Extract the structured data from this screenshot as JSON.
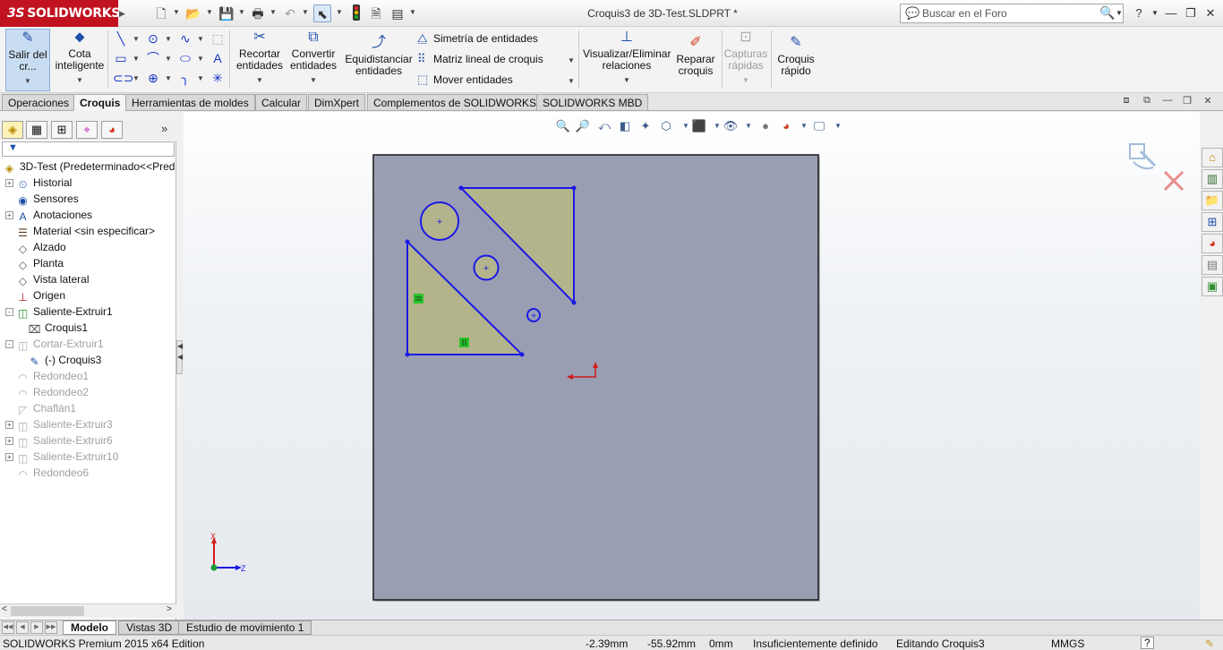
{
  "titlebar": {
    "brand": "SOLIDWORKS",
    "brand_prefix": "3S",
    "document_title": "Croquis3 de 3D-Test.SLDPRT *",
    "search_placeholder": "Buscar en el Foro",
    "help_label": "?",
    "icons": [
      "new-document-icon",
      "open-folder-icon",
      "save-icon",
      "print-icon",
      "undo-icon",
      "select-arrow-icon",
      "rebuild-traffic-light-icon",
      "file-properties-icon",
      "options-icon"
    ]
  },
  "ribbon": {
    "exit_sketch": "Salir del cr...",
    "smart_dimension": [
      "Cota",
      "inteligente"
    ],
    "trim": [
      "Recortar",
      "entidades"
    ],
    "convert": [
      "Convertir",
      "entidades"
    ],
    "offset": [
      "Equidistanciar",
      "entidades"
    ],
    "mirror": "Simetría de entidades",
    "linear_pattern": "Matriz lineal de croquis",
    "move": "Mover entidades",
    "relations": [
      "Visualizar/Eliminar",
      "relaciones"
    ],
    "repair": [
      "Reparar",
      "croquis"
    ],
    "quick_snaps": [
      "Capturas",
      "rápidas"
    ],
    "rapid_sketch": [
      "Croquis",
      "rápido"
    ]
  },
  "command_tabs": [
    {
      "label": "Operaciones",
      "active": false
    },
    {
      "label": "Croquis",
      "active": true
    },
    {
      "label": "Herramientas de moldes",
      "active": false
    },
    {
      "label": "Calcular",
      "active": false
    },
    {
      "label": "DimXpert",
      "active": false
    },
    {
      "label": "Complementos de SOLIDWORKS",
      "active": false
    },
    {
      "label": "SOLIDWORKS MBD",
      "active": false
    }
  ],
  "feature_tree": {
    "root": "3D-Test  (Predeterminado<<Pred",
    "items": [
      {
        "label": "Historial",
        "icon": "history-icon",
        "expander": "+",
        "dim": false
      },
      {
        "label": "Sensores",
        "icon": "sensor-icon",
        "expander": "",
        "dim": false
      },
      {
        "label": "Anotaciones",
        "icon": "annotations-icon",
        "expander": "+",
        "dim": false
      },
      {
        "label": "Material <sin especificar>",
        "icon": "material-icon",
        "expander": "",
        "dim": false
      },
      {
        "label": "Alzado",
        "icon": "plane-icon",
        "expander": "",
        "dim": false
      },
      {
        "label": "Planta",
        "icon": "plane-icon",
        "expander": "",
        "dim": false
      },
      {
        "label": "Vista lateral",
        "icon": "plane-icon",
        "expander": "",
        "dim": false
      },
      {
        "label": "Origen",
        "icon": "origin-icon",
        "expander": "",
        "dim": false
      },
      {
        "label": "Saliente-Extruir1",
        "icon": "extrude-boss-icon",
        "expander": "-",
        "dim": false
      },
      {
        "label": "Croquis1",
        "icon": "sketch-icon",
        "expander": "",
        "dim": false,
        "child": true
      },
      {
        "label": "Cortar-Extruir1",
        "icon": "extrude-cut-icon",
        "expander": "-",
        "dim": true
      },
      {
        "label": "(-) Croquis3",
        "icon": "edit-sketch-icon",
        "expander": "",
        "dim": false,
        "child": true
      },
      {
        "label": "Redondeo1",
        "icon": "fillet-icon",
        "expander": "",
        "dim": true
      },
      {
        "label": "Redondeo2",
        "icon": "fillet-icon",
        "expander": "",
        "dim": true
      },
      {
        "label": "Chaflán1",
        "icon": "chamfer-icon",
        "expander": "",
        "dim": true
      },
      {
        "label": "Saliente-Extruir3",
        "icon": "extrude-boss-icon",
        "expander": "+",
        "dim": true
      },
      {
        "label": "Saliente-Extruir6",
        "icon": "extrude-boss-icon",
        "expander": "+",
        "dim": true
      },
      {
        "label": "Saliente-Extruir10",
        "icon": "extrude-boss-icon",
        "expander": "+",
        "dim": true
      },
      {
        "label": "Redondeo6",
        "icon": "fillet-icon",
        "expander": "",
        "dim": true
      }
    ]
  },
  "triad": {
    "x_label": "X",
    "z_label": "Z"
  },
  "bottom_tabs": [
    {
      "label": "Modelo",
      "active": true
    },
    {
      "label": "Vistas 3D",
      "active": false
    },
    {
      "label": "Estudio de movimiento 1",
      "active": false
    }
  ],
  "status": {
    "edition": "SOLIDWORKS Premium 2015 x64 Edition",
    "x": "-2.39mm",
    "y": "-55.92mm",
    "z": "0mm",
    "definition": "Insuficientemente definido",
    "mode": "Editando Croquis3",
    "units": "MMGS",
    "help": "?"
  },
  "colors": {
    "brand_red": "#c1121f",
    "sketch_blue": "#1a1ae6",
    "plane_face": "#9a9eb3",
    "region_fill": "#b4b48c"
  }
}
